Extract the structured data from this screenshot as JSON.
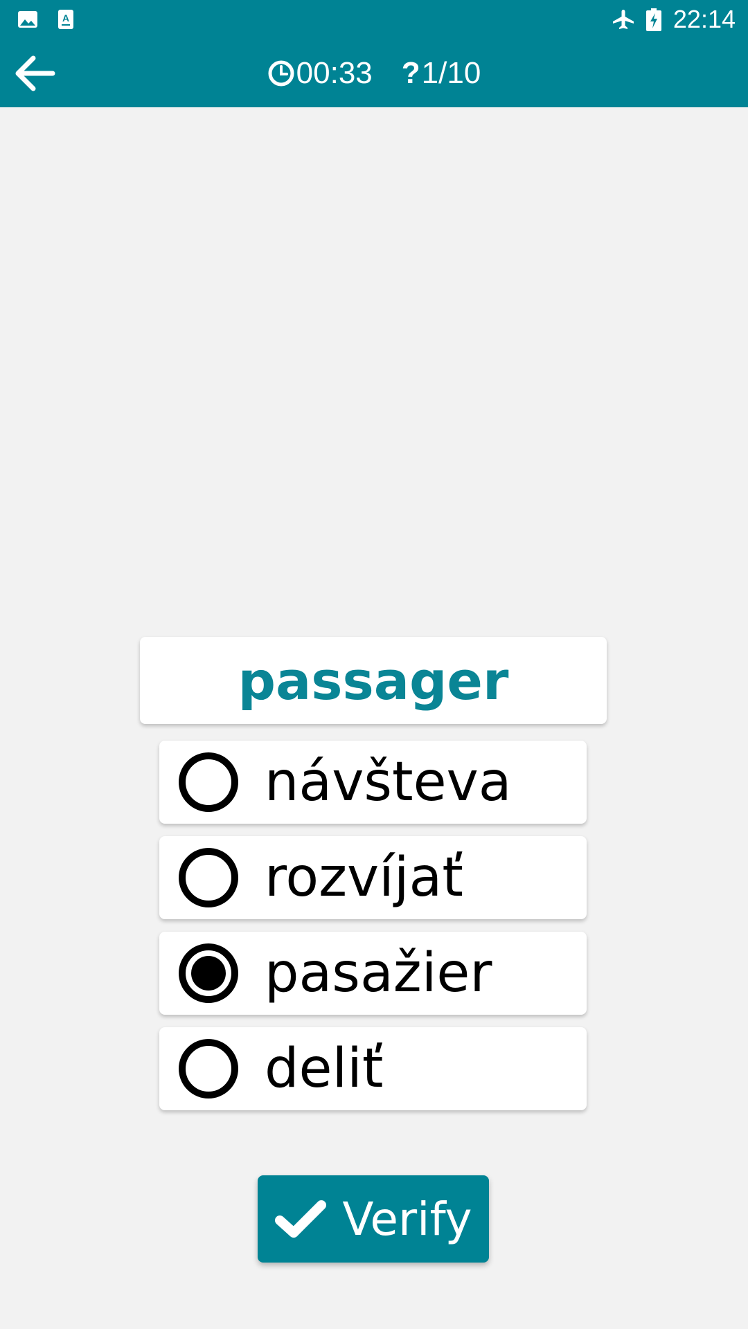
{
  "status_bar": {
    "time": "22:14",
    "icons": [
      "gallery-icon",
      "translate-app-icon",
      "airplane-mode-icon",
      "battery-charging-icon"
    ]
  },
  "toolbar": {
    "back_icon": "arrow-back-icon",
    "timer_icon": "clock-icon",
    "timer_value": "00:33",
    "question_symbol": "?",
    "question_counter": "1/10"
  },
  "quiz": {
    "word": "passager",
    "options": [
      {
        "label": "návšteva",
        "selected": false
      },
      {
        "label": "rozvíjať",
        "selected": false
      },
      {
        "label": "pasažier",
        "selected": true
      },
      {
        "label": "deliť",
        "selected": false
      }
    ]
  },
  "verify_button": {
    "label": "Verify",
    "icon": "checkmark-icon"
  },
  "colors": {
    "primary": "#008394",
    "word_text": "#0a8595",
    "background": "#f2f2f2"
  }
}
